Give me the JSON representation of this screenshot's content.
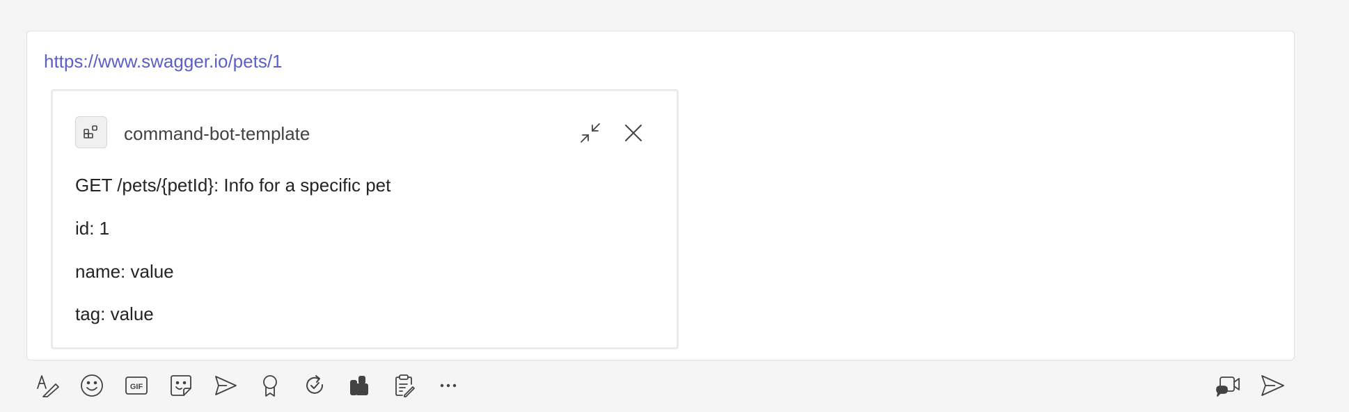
{
  "message": {
    "link_text": "https://www.swagger.io/pets/1"
  },
  "card": {
    "app_icon": "apps-icon",
    "app_name": "command-bot-template",
    "title": "GET /pets/{petId}: Info for a specific pet",
    "fields": [
      {
        "text": "id: 1"
      },
      {
        "text": "name: value"
      },
      {
        "text": "tag: value"
      }
    ],
    "actions": [
      "collapse-icon",
      "close-icon"
    ]
  },
  "toolbar": {
    "left_icons": [
      "format-icon",
      "emoji-icon",
      "gif-icon",
      "sticker-icon",
      "schedule-send-icon",
      "praise-icon",
      "loop-icon",
      "apps-icon",
      "notes-icon",
      "more-icon"
    ],
    "right_icons": [
      "meet-now-icon",
      "send-icon"
    ],
    "gif_label": "GIF"
  },
  "colors": {
    "link": "#5b5fc7",
    "background": "#f5f5f5",
    "text": "#242424"
  }
}
